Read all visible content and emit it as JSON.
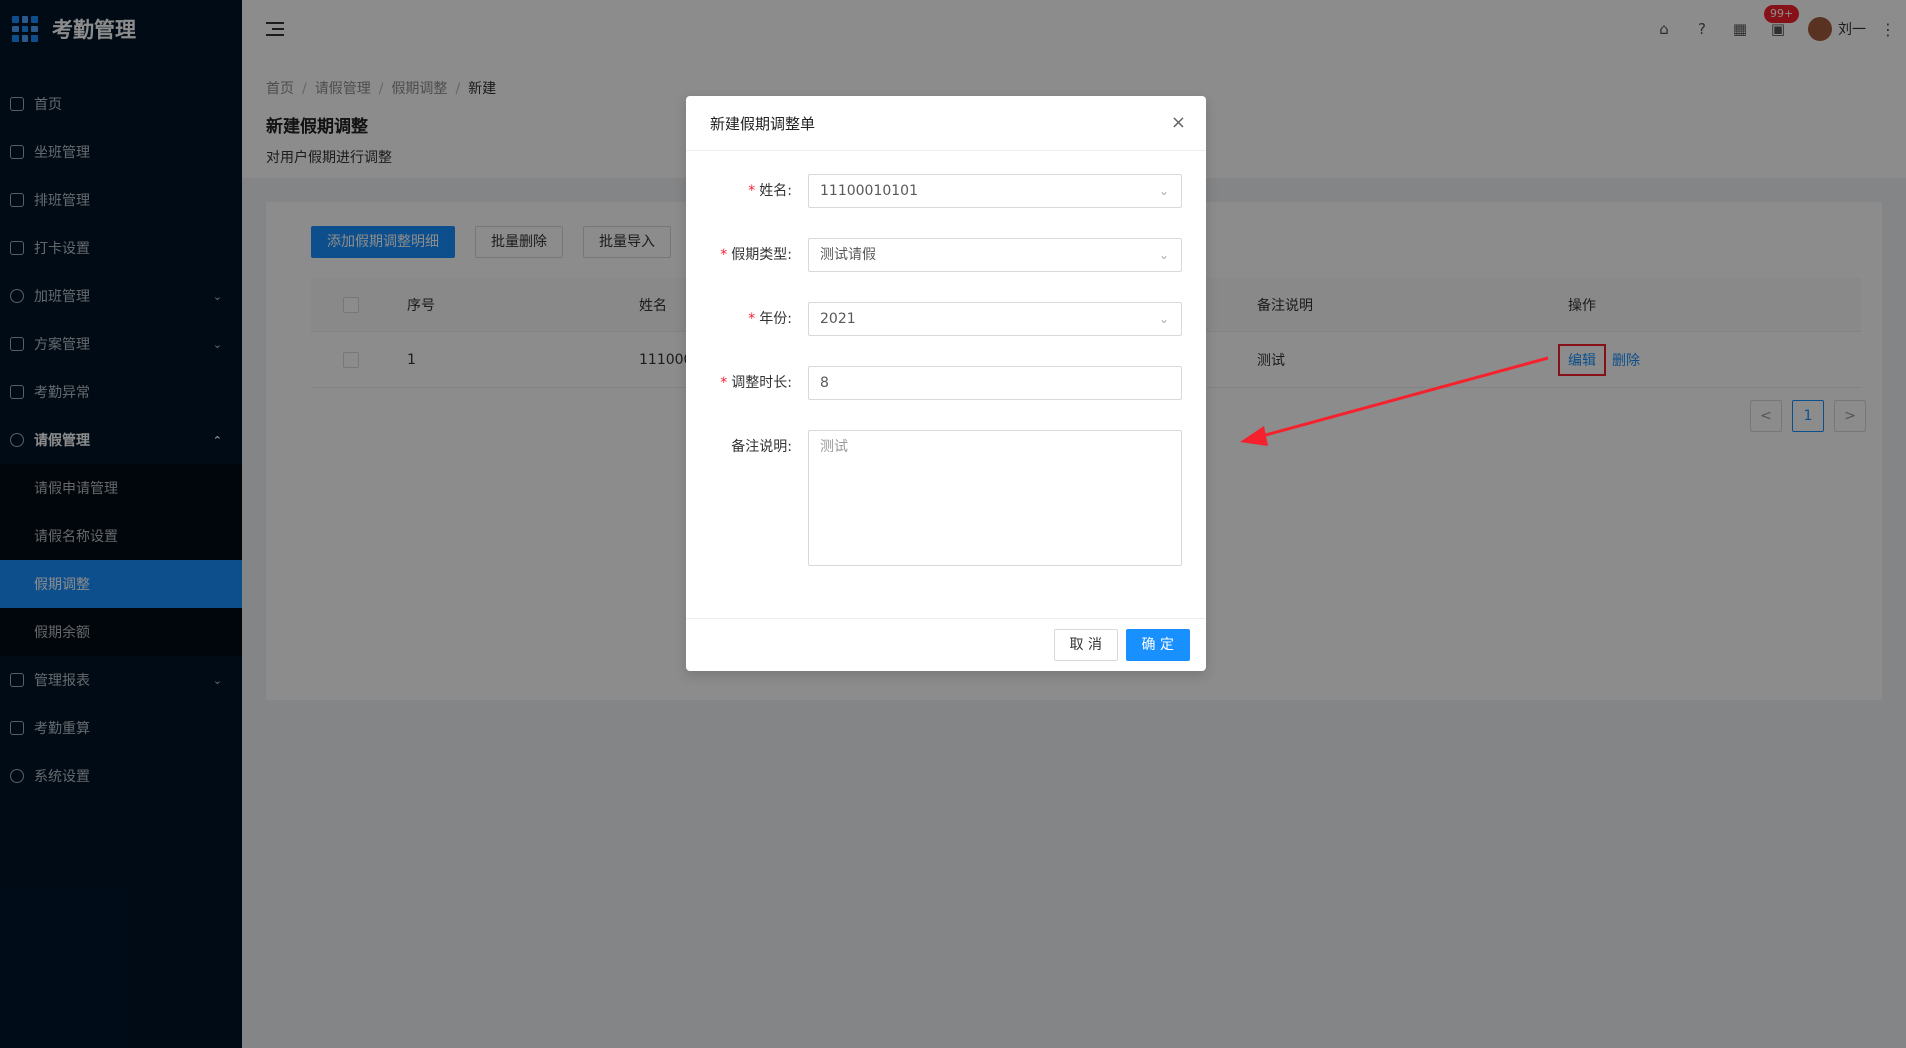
{
  "app": {
    "title": "考勤管理"
  },
  "sidebar": {
    "items": [
      {
        "label": "首页"
      },
      {
        "label": "坐班管理"
      },
      {
        "label": "排班管理"
      },
      {
        "label": "打卡设置"
      },
      {
        "label": "加班管理"
      },
      {
        "label": "方案管理"
      },
      {
        "label": "考勤异常"
      },
      {
        "label": "请假管理"
      },
      {
        "label": "管理报表"
      },
      {
        "label": "考勤重算"
      },
      {
        "label": "系统设置"
      }
    ],
    "sub": [
      {
        "label": "请假申请管理"
      },
      {
        "label": "请假名称设置"
      },
      {
        "label": "假期调整"
      },
      {
        "label": "假期余额"
      }
    ]
  },
  "header": {
    "badge": "99+",
    "user": "刘一"
  },
  "breadcrumb": [
    "首页",
    "请假管理",
    "假期调整",
    "新建"
  ],
  "page": {
    "title": "新建假期调整",
    "desc": "对用户假期进行调整"
  },
  "toolbar": {
    "add": "添加假期调整明细",
    "batch_delete": "批量删除",
    "batch_import": "批量导入"
  },
  "table": {
    "headers": {
      "index": "序号",
      "name": "姓名",
      "remark": "备注说明",
      "action": "操作"
    },
    "rows": [
      {
        "index": "1",
        "name": "1110001",
        "remark": "测试",
        "edit": "编辑",
        "delete": "删除"
      }
    ]
  },
  "pagination": {
    "prev": "<",
    "current": "1",
    "next": ">"
  },
  "modal": {
    "title": "新建假期调整单",
    "close": "×",
    "fields": {
      "name_label": "姓名:",
      "name_value": "11100010101",
      "type_label": "假期类型:",
      "type_value": "测试请假",
      "year_label": "年份:",
      "year_value": "2021",
      "duration_label": "调整时长:",
      "duration_value": "8",
      "remark_label": "备注说明:",
      "remark_value": "测试"
    },
    "cancel": "取 消",
    "ok": "确 定"
  }
}
